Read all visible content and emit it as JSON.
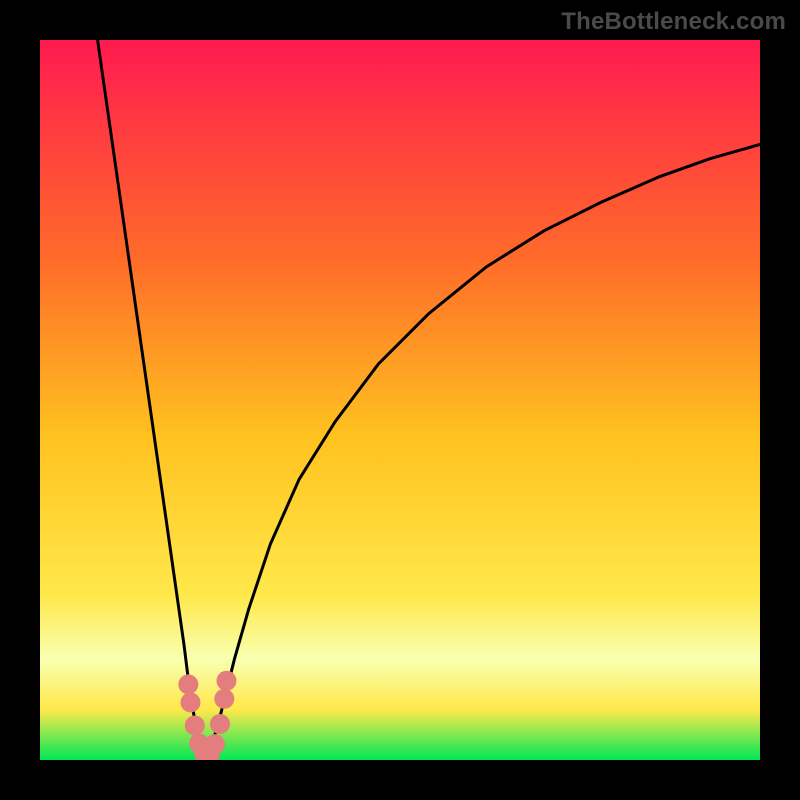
{
  "watermark": "TheBottleneck.com",
  "colors": {
    "frame": "#000000",
    "gradient_top": "#ff1a50",
    "gradient_mid1": "#ff6a2a",
    "gradient_mid2": "#ffc21f",
    "gradient_mid3": "#ffe84a",
    "gradient_low_pale": "#f8ffb0",
    "gradient_bottom": "#00e756",
    "curve": "#000000",
    "marker": "#e47e7e"
  },
  "chart_data": {
    "type": "line",
    "title": "",
    "xlabel": "",
    "ylabel": "",
    "xlim": [
      0,
      100
    ],
    "ylim": [
      0,
      100
    ],
    "series": [
      {
        "name": "left-branch",
        "x": [
          8,
          9,
          10,
          11,
          12,
          13,
          14,
          15,
          16,
          17,
          18,
          19,
          20,
          20.5,
          21,
          21.5,
          22,
          22.3,
          22.6,
          23
        ],
        "y": [
          100,
          93,
          86,
          79,
          72,
          65,
          58,
          51,
          44,
          37,
          30,
          23,
          16,
          12,
          8.5,
          5.5,
          3.3,
          2.1,
          1.2,
          0.4
        ]
      },
      {
        "name": "right-branch",
        "x": [
          23,
          23.5,
          24,
          24.5,
          25,
          26,
          27,
          29,
          32,
          36,
          41,
          47,
          54,
          62,
          70,
          78,
          86,
          93,
          100
        ],
        "y": [
          0.4,
          1.3,
          2.6,
          4.2,
          6.0,
          10.0,
          14.0,
          21.0,
          30.0,
          39.0,
          47.0,
          55.0,
          62.0,
          68.5,
          73.5,
          77.5,
          81.0,
          83.5,
          85.5
        ]
      }
    ],
    "markers": {
      "name": "highlight-cluster",
      "points": [
        {
          "x": 20.6,
          "y": 10.5
        },
        {
          "x": 20.9,
          "y": 8.0
        },
        {
          "x": 21.5,
          "y": 4.8
        },
        {
          "x": 22.1,
          "y": 2.3
        },
        {
          "x": 22.8,
          "y": 0.9
        },
        {
          "x": 23.6,
          "y": 0.8
        },
        {
          "x": 24.3,
          "y": 2.2
        },
        {
          "x": 25.0,
          "y": 5.0
        },
        {
          "x": 25.6,
          "y": 8.5
        },
        {
          "x": 25.9,
          "y": 11.0
        }
      ],
      "radius": 10
    },
    "optimum_x": 23,
    "gradient_stops": [
      {
        "pos": 0.0,
        "color_key": "gradient_top"
      },
      {
        "pos": 0.3,
        "color_key": "gradient_mid1"
      },
      {
        "pos": 0.55,
        "color_key": "gradient_mid2"
      },
      {
        "pos": 0.77,
        "color_key": "gradient_mid3"
      },
      {
        "pos": 0.86,
        "color_key": "gradient_low_pale"
      },
      {
        "pos": 0.93,
        "color_key": "gradient_mid3"
      },
      {
        "pos": 1.0,
        "color_key": "gradient_bottom"
      }
    ]
  }
}
